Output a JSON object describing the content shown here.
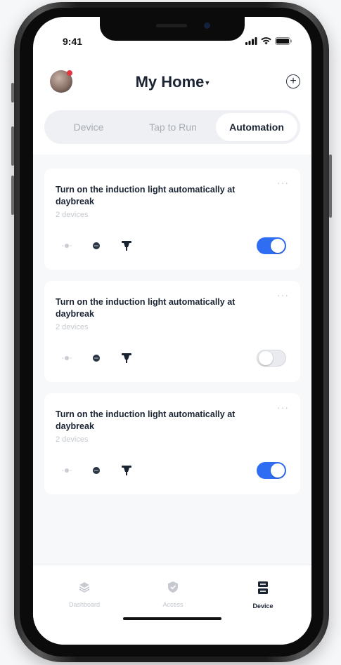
{
  "status_bar": {
    "time": "9:41"
  },
  "header": {
    "title": "My Home",
    "caret": "▾",
    "add_icon": "plus-circle-icon"
  },
  "tabs": [
    {
      "label": "Device",
      "active": false
    },
    {
      "label": "Tap to Run",
      "active": false
    },
    {
      "label": "Automation",
      "active": true
    }
  ],
  "automations": [
    {
      "title": "Turn on the induction light automatically at daybreak",
      "subtitle": "2 devices",
      "more": "···",
      "enabled": true
    },
    {
      "title": "Turn on the induction light automatically at daybreak",
      "subtitle": "2 devices",
      "more": "···",
      "enabled": false
    },
    {
      "title": "Turn on the induction light automatically at daybreak",
      "subtitle": "2 devices",
      "more": "···",
      "enabled": true
    }
  ],
  "bottom_nav": [
    {
      "label": "Dashboard",
      "icon": "layers-icon",
      "active": false
    },
    {
      "label": "Access",
      "icon": "shield-icon",
      "active": false
    },
    {
      "label": "Device",
      "icon": "device-icon",
      "active": true
    }
  ],
  "colors": {
    "accent": "#2f6ef3",
    "text_dark": "#1b2433",
    "muted": "#c5c9cf"
  }
}
